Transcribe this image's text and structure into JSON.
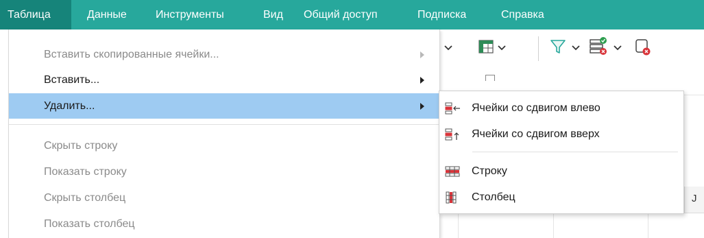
{
  "menubar": {
    "items": [
      "Таблица",
      "Данные",
      "Инструменты",
      "Вид",
      "Общий доступ",
      "Подписка",
      "Справка"
    ],
    "active_index": 0
  },
  "menu": {
    "items": [
      {
        "label": "Вставить скопированные ячейки...",
        "state": "disabled",
        "submenu": true
      },
      {
        "label": "Вставить...",
        "state": "enabled",
        "submenu": true
      },
      {
        "label": "Удалить...",
        "state": "highlighted",
        "submenu": true
      },
      {
        "label": "Скрыть строку",
        "state": "disabled"
      },
      {
        "label": "Показать строку",
        "state": "disabled"
      },
      {
        "label": "Скрыть столбец",
        "state": "disabled"
      },
      {
        "label": "Показать столбец",
        "state": "disabled"
      }
    ]
  },
  "submenu": {
    "items": [
      {
        "label": "Ячейки со сдвигом влево",
        "icon": "delete-cells-shift-left-icon"
      },
      {
        "label": "Ячейки со сдвигом вверх",
        "icon": "delete-cells-shift-up-icon"
      },
      {
        "label": "Строку",
        "icon": "delete-row-icon"
      },
      {
        "label": "Столбец",
        "icon": "delete-column-icon"
      }
    ]
  },
  "grid": {
    "column_header": "J"
  },
  "colors": {
    "menubar": "#27a89c",
    "menubar_active": "#16847a",
    "highlight": "#9ecbf2",
    "delete_red": "#d9343a"
  }
}
